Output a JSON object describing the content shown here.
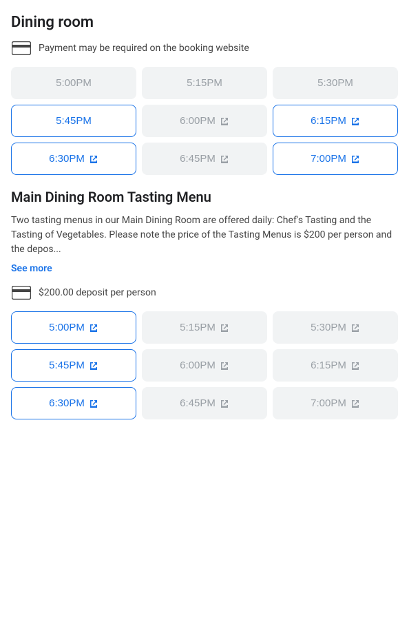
{
  "dining_room": {
    "title": "Dining room",
    "payment_notice": "Payment may be required on the booking website",
    "time_slots_1": [
      {
        "time": "5:00PM",
        "state": "unavailable",
        "external": false
      },
      {
        "time": "5:15PM",
        "state": "unavailable",
        "external": false
      },
      {
        "time": "5:30PM",
        "state": "unavailable",
        "external": false
      },
      {
        "time": "5:45PM",
        "state": "available",
        "external": false
      },
      {
        "time": "6:00PM",
        "state": "external",
        "external": true
      },
      {
        "time": "6:15PM",
        "state": "available-external",
        "external": true
      },
      {
        "time": "6:30PM",
        "state": "available-external",
        "external": true
      },
      {
        "time": "6:45PM",
        "state": "external",
        "external": true
      },
      {
        "time": "7:00PM",
        "state": "available-external",
        "external": true
      }
    ]
  },
  "tasting_menu": {
    "title": "Main Dining Room Tasting Menu",
    "description": "Two tasting menus in our Main Dining Room are offered daily: Chef's Tasting and the Tasting of Vegetables. Please note the price of the Tasting Menus is $200 per person and the depos...",
    "see_more_label": "See more",
    "deposit_notice": "$200.00 deposit per person",
    "time_slots_2": [
      {
        "time": "5:00PM",
        "state": "available-external",
        "external": true
      },
      {
        "time": "5:15PM",
        "state": "external",
        "external": true
      },
      {
        "time": "5:30PM",
        "state": "external",
        "external": true
      },
      {
        "time": "5:45PM",
        "state": "available-external",
        "external": true
      },
      {
        "time": "6:00PM",
        "state": "external",
        "external": true
      },
      {
        "time": "6:15PM",
        "state": "external",
        "external": true
      },
      {
        "time": "6:30PM",
        "state": "available-external",
        "external": true
      },
      {
        "time": "6:45PM",
        "state": "external",
        "external": true
      },
      {
        "time": "7:00PM",
        "state": "external",
        "external": true
      }
    ]
  },
  "icons": {
    "external_link": "⬡",
    "card": "card"
  }
}
